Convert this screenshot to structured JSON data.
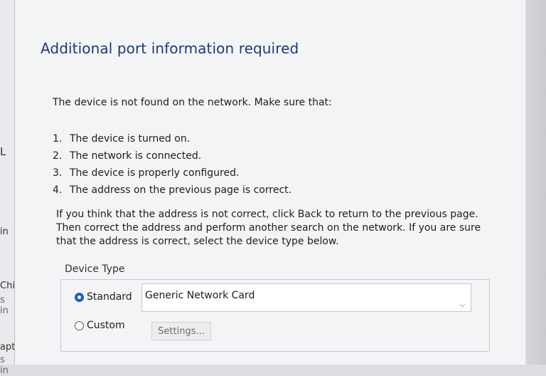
{
  "background": {
    "fragments": [
      "L",
      "in",
      "Chi",
      "s in",
      "apt",
      "s in"
    ]
  },
  "dialog": {
    "title": "Additional port information required",
    "message": "The device is not found on the network. Make sure that:",
    "checks": [
      {
        "num": "1.",
        "text": "The device is turned on."
      },
      {
        "num": "2.",
        "text": "The network is connected."
      },
      {
        "num": "3.",
        "text": "The device is properly configured."
      },
      {
        "num": "4.",
        "text": "The address on the previous page is correct."
      }
    ],
    "paragraph": "If you think that the address is not correct, click Back to return to the previous page. Then correct the address and perform another search on the network. If you are sure that the address is correct, select the device type below.",
    "device_type": {
      "label": "Device Type",
      "standard_label": "Standard",
      "standard_selected": true,
      "standard_value": "Generic Network Card",
      "custom_label": "Custom",
      "custom_selected": false,
      "settings_label": "Settings..."
    }
  },
  "colors": {
    "title": "#1d3a7a",
    "radio_accent": "#1f5fbf"
  }
}
